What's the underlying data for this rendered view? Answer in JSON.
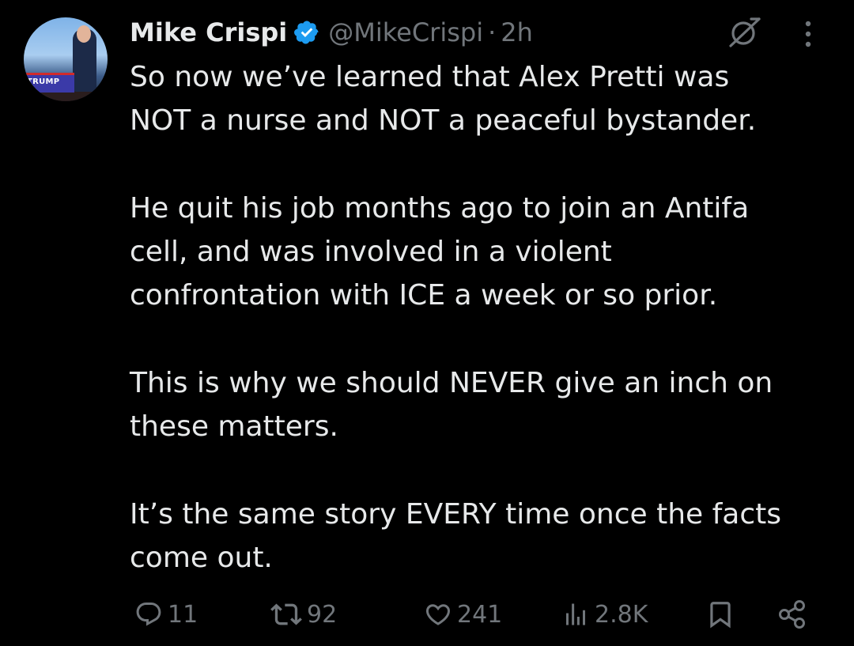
{
  "author": {
    "name": "Mike Crispi",
    "handle": "@MikeCrispi",
    "separator": "·",
    "time": "2h",
    "verified": true,
    "avatar_sign_text": "TRUMP"
  },
  "tweet": {
    "paragraphs": [
      "So now we’ve learned that Alex Pretti was\nNOT a nurse and NOT a peaceful bystander.",
      "He quit his job months ago to join an Antifa\ncell, and was involved in a violent\nconfrontation with ICE a week or so prior.",
      "This is why we should NEVER give an inch on\nthese matters.",
      "It’s the same story EVERY time once the facts\ncome out."
    ]
  },
  "actions": {
    "replies": "11",
    "retweets": "92",
    "likes": "241",
    "views": "2.8K"
  },
  "icons": {
    "verified": "verified-badge-icon",
    "grok": "grok-icon",
    "more": "more-options-icon",
    "reply": "reply-icon",
    "retweet": "retweet-icon",
    "like": "heart-icon",
    "views": "views-chart-icon",
    "bookmark": "bookmark-icon",
    "share": "share-icon"
  },
  "colors": {
    "background": "#000000",
    "text_primary": "#e7e9ea",
    "text_secondary": "#71767b",
    "verified_blue": "#1d9bf0"
  }
}
